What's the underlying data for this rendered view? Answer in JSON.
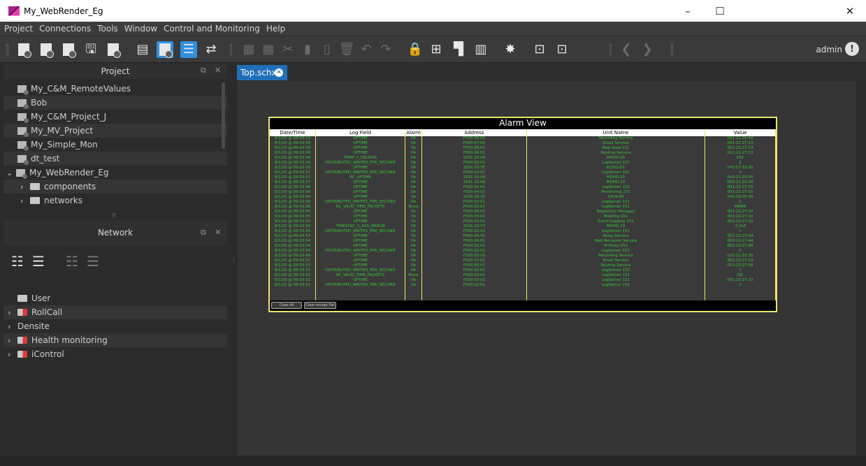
{
  "window": {
    "title": "My_WebRender_Eg",
    "minimize": "–",
    "maximize": "☐",
    "close": "✕"
  },
  "menu": [
    "Project",
    "Connections",
    "Tools",
    "Window",
    "Control and Monitoring",
    "Help"
  ],
  "toolbar": {
    "user": "admin"
  },
  "project_panel": {
    "title": "Project",
    "items": [
      {
        "label": "My_C&M_RemoteValues",
        "indent": 0,
        "kind": "project"
      },
      {
        "label": "Bob",
        "indent": 0,
        "kind": "project"
      },
      {
        "label": "My_C&M_Project_J",
        "indent": 0,
        "kind": "project"
      },
      {
        "label": "My_MV_Project",
        "indent": 0,
        "kind": "project"
      },
      {
        "label": "My_Simple_Mon",
        "indent": 0,
        "kind": "project"
      },
      {
        "label": "dt_test",
        "indent": 0,
        "kind": "project"
      },
      {
        "label": "My_WebRender_Eg",
        "indent": 0,
        "kind": "project-open"
      },
      {
        "label": "components",
        "indent": 1,
        "kind": "folder"
      },
      {
        "label": "networks",
        "indent": 1,
        "kind": "folder"
      }
    ]
  },
  "network_panel": {
    "title": "Network",
    "items": [
      {
        "label": "User",
        "kind": "folder-plain"
      },
      {
        "label": "RollCall",
        "kind": "folder-red"
      },
      {
        "label": "Densite",
        "kind": "none"
      },
      {
        "label": "Health monitoring",
        "kind": "folder-red"
      },
      {
        "label": "iControl",
        "kind": "folder-red"
      }
    ]
  },
  "editor": {
    "tab_label": "Top.schx"
  },
  "alarm_view": {
    "title": "Alarm View",
    "columns": [
      "Date/Time",
      "Log Field",
      "Alarm",
      "Address",
      "Unit Name",
      "Value"
    ],
    "rows": [
      [
        "8/1/20 @ 08:58:53",
        "UPTIME",
        "Ok",
        "F100:05:00",
        "Recording Service",
        "021:21:31:40"
      ],
      [
        "8/1/20 @ 09:03:58",
        "UPTIME",
        "Ok",
        "F000:07:01",
        "Email Service",
        "001:22:27:13"
      ],
      [
        "8/1/20 @ 09:03:58",
        "UPTIME",
        "Ok",
        "F000:08:01",
        "Map View 151",
        "001:22:27:13"
      ],
      [
        "8/1/20 @ 09:03:58",
        "UPTIME",
        "Ok",
        "F000:06:01",
        "Routing Service",
        "001:22:27:13"
      ],
      [
        "8/1/20 @ 09:03:58",
        "TEMP_1_CELSIUS",
        "Ok",
        "3291:20:0A",
        "MDHD-20",
        "43C"
      ],
      [
        "8/1/20 @ 09:03:58",
        "DISTRIBUTED_WRITES_PER_SECOND",
        "Ok",
        "F000:02:01",
        "LogServer 151",
        "1"
      ],
      [
        "8/1/20 @ 09:03:58",
        "UPTIME",
        "Ok",
        "3291:20:0F",
        "ECHO101",
        "043:17:32:00"
      ],
      [
        "8/1/20 @ 09:03:57",
        "DISTRIBUTED_WRITES_PER_SECOND",
        "Ok",
        "F000:02:01",
        "LogServer 151",
        "3"
      ],
      [
        "8/1/20 @ 09:03:57",
        "RC_UPTIME",
        "Ok",
        "3291:20:0A",
        "MDHD-20",
        "000:21:20:00"
      ],
      [
        "8/1/20 @ 09:03:57",
        "UPTIME",
        "Ok",
        "3291:20:0A",
        "MDHD-20",
        "000:21:21:00"
      ],
      [
        "8/1/20 @ 09:03:56",
        "UPTIME",
        "Ok",
        "F000:02:01",
        "LogServer 151",
        "001:22:27:15"
      ],
      [
        "8/1/20 @ 09:03:56",
        "UPTIME",
        "Ok",
        "F000:04:01",
        "Monitoring 151",
        "001:22:27:10"
      ],
      [
        "8/1/20 @ 09:03:56",
        "UPTIME",
        "Ok",
        "3291:30:00",
        "IQCA-00",
        "043:18:35:00"
      ],
      [
        "8/1/20 @ 09:03:56",
        "DISTRIBUTED_WRITES_PER_SECOND",
        "Ok",
        "F000:02:01",
        "LogServer 151",
        "2"
      ],
      [
        "8/1/20 @ 09:03:56",
        "RC_VALID_TIME_PACKETS",
        "None",
        "F000:02:01",
        "LogServer 151",
        "WARN"
      ],
      [
        "8/1/20 @ 09:03:55",
        "UPTIME",
        "Ok",
        "F000:08:01",
        "Repository Manager",
        "001:22:27:10"
      ],
      [
        "8/1/20 @ 09:03:55",
        "UPTIME",
        "Ok",
        "F000:03:01",
        "Meeting 151",
        "001:22:27:10"
      ],
      [
        "8/1/20 @ 09:03:55",
        "UPTIME",
        "Ok",
        "F000:05:01",
        "Event Logging 151",
        "001:22:27:10"
      ],
      [
        "8/1/20 @ 09:03:55",
        "TIMESYNC_1_AVG_ERROR",
        "Ok",
        "3291:20:07",
        "MDHD-19",
        "-0.0x5"
      ],
      [
        "8/1/20 @ 09:03:55",
        "DISTRIBUTED_WRITES_PER_SECOND",
        "Ok",
        "F000:02:01",
        "LogServer 151",
        "1"
      ],
      [
        "8/1/20 @ 09:03:54",
        "UPTIME",
        "Ok",
        "F000:0A:01",
        "Relay Service",
        "001:22:27:09"
      ],
      [
        "8/1/20 @ 09:03:54",
        "UPTIME",
        "Ok",
        "F000:09:01",
        "Web Renderer Service",
        "000:10:17:44"
      ],
      [
        "8/1/20 @ 09:03:54",
        "UPTIME",
        "Ok",
        "F000:01:01",
        "IP Proxy 151",
        "001:22:27:00"
      ],
      [
        "8/1/20 @ 09:03:54",
        "DISTRIBUTED_WRITES_PER_SECOND",
        "Ok",
        "F000:02:01",
        "LogServer 151",
        "0"
      ],
      [
        "8/1/20 @ 09:03:48",
        "UPTIME",
        "Ok",
        "F100:05:00",
        "Recording Service",
        "021:21:31:35"
      ],
      [
        "8/1/20 @ 09:03:53",
        "UPTIME",
        "Ok",
        "F000:07:01",
        "Email Service",
        "001:22:27:10"
      ],
      [
        "8/1/20 @ 09:03:53",
        "UPTIME",
        "Ok",
        "F000:06:01",
        "Routing Service",
        "001:22:27:08"
      ],
      [
        "8/1/20 @ 09:03:52",
        "DISTRIBUTED_WRITES_PER_SECOND",
        "Ok",
        "F000:02:01",
        "LogServer 151",
        "1"
      ],
      [
        "8/1/20 @ 09:03:52",
        "RC_VALID_TIME_PACKETS",
        "None",
        "F000:02:01",
        "LogServer 151",
        "OK"
      ],
      [
        "8/1/20 @ 09:03:51",
        "UPTIME",
        "Ok",
        "F000:02:01",
        "LogServer 151",
        "001:22:27:10"
      ],
      [
        "8/1/20 @ 09:03:51",
        "DISTRIBUTED_WRITES_PER_SECOND",
        "Ok",
        "F000:02:01",
        "LogServer 151",
        "2"
      ]
    ],
    "buttons": [
      "Clear All",
      "Clear except Fail"
    ]
  }
}
